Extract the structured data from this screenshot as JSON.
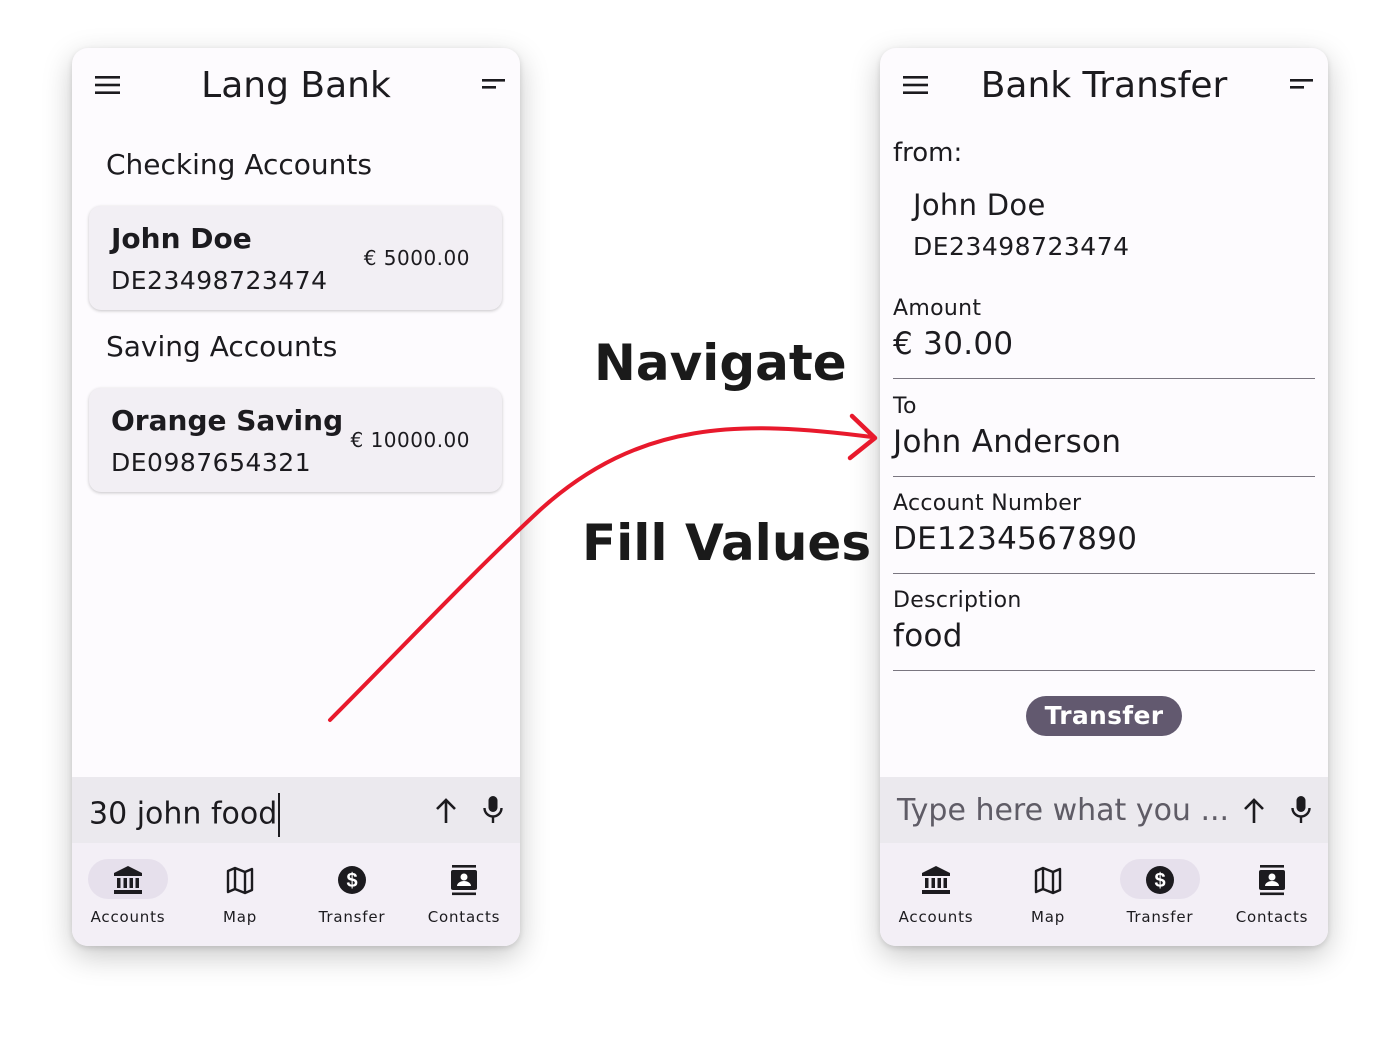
{
  "left_screen": {
    "title": "Lang Bank",
    "checking_title": "Checking Accounts",
    "checking_account": {
      "name": "John Doe",
      "iban": "DE23498723474",
      "balance": "€ 5000.00"
    },
    "saving_title": "Saving Accounts",
    "saving_account": {
      "name": "Orange Saving",
      "iban": "DE0987654321",
      "balance": "€ 10000.00"
    },
    "input_value": "30 john food",
    "nav": [
      {
        "label": "Accounts",
        "icon": "bank-icon",
        "active": true
      },
      {
        "label": "Map",
        "icon": "map-icon",
        "active": false
      },
      {
        "label": "Transfer",
        "icon": "dollar-circle-icon",
        "active": false
      },
      {
        "label": "Contacts",
        "icon": "contacts-icon",
        "active": false
      }
    ]
  },
  "right_screen": {
    "title": "Bank Transfer",
    "from_label": "from:",
    "from_name": "John Doe",
    "from_iban": "DE23498723474",
    "fields": {
      "amount": {
        "label": "Amount",
        "value": "€ 30.00"
      },
      "to": {
        "label": "To",
        "value": "John Anderson"
      },
      "account_number": {
        "label": "Account Number",
        "value": "DE1234567890"
      },
      "description": {
        "label": "Description",
        "value": "food"
      }
    },
    "transfer_button": "Transfer",
    "input_placeholder": "Type here what you ...",
    "nav": [
      {
        "label": "Accounts",
        "icon": "bank-icon",
        "active": false
      },
      {
        "label": "Map",
        "icon": "map-icon",
        "active": false
      },
      {
        "label": "Transfer",
        "icon": "dollar-circle-icon",
        "active": true
      },
      {
        "label": "Contacts",
        "icon": "contacts-icon",
        "active": false
      }
    ]
  },
  "captions": {
    "navigate": "Navigate",
    "fill_values": "Fill Values"
  },
  "colors": {
    "arrow": "#e8192c",
    "button": "#62596f",
    "nav_active": "#e6e0ec"
  }
}
